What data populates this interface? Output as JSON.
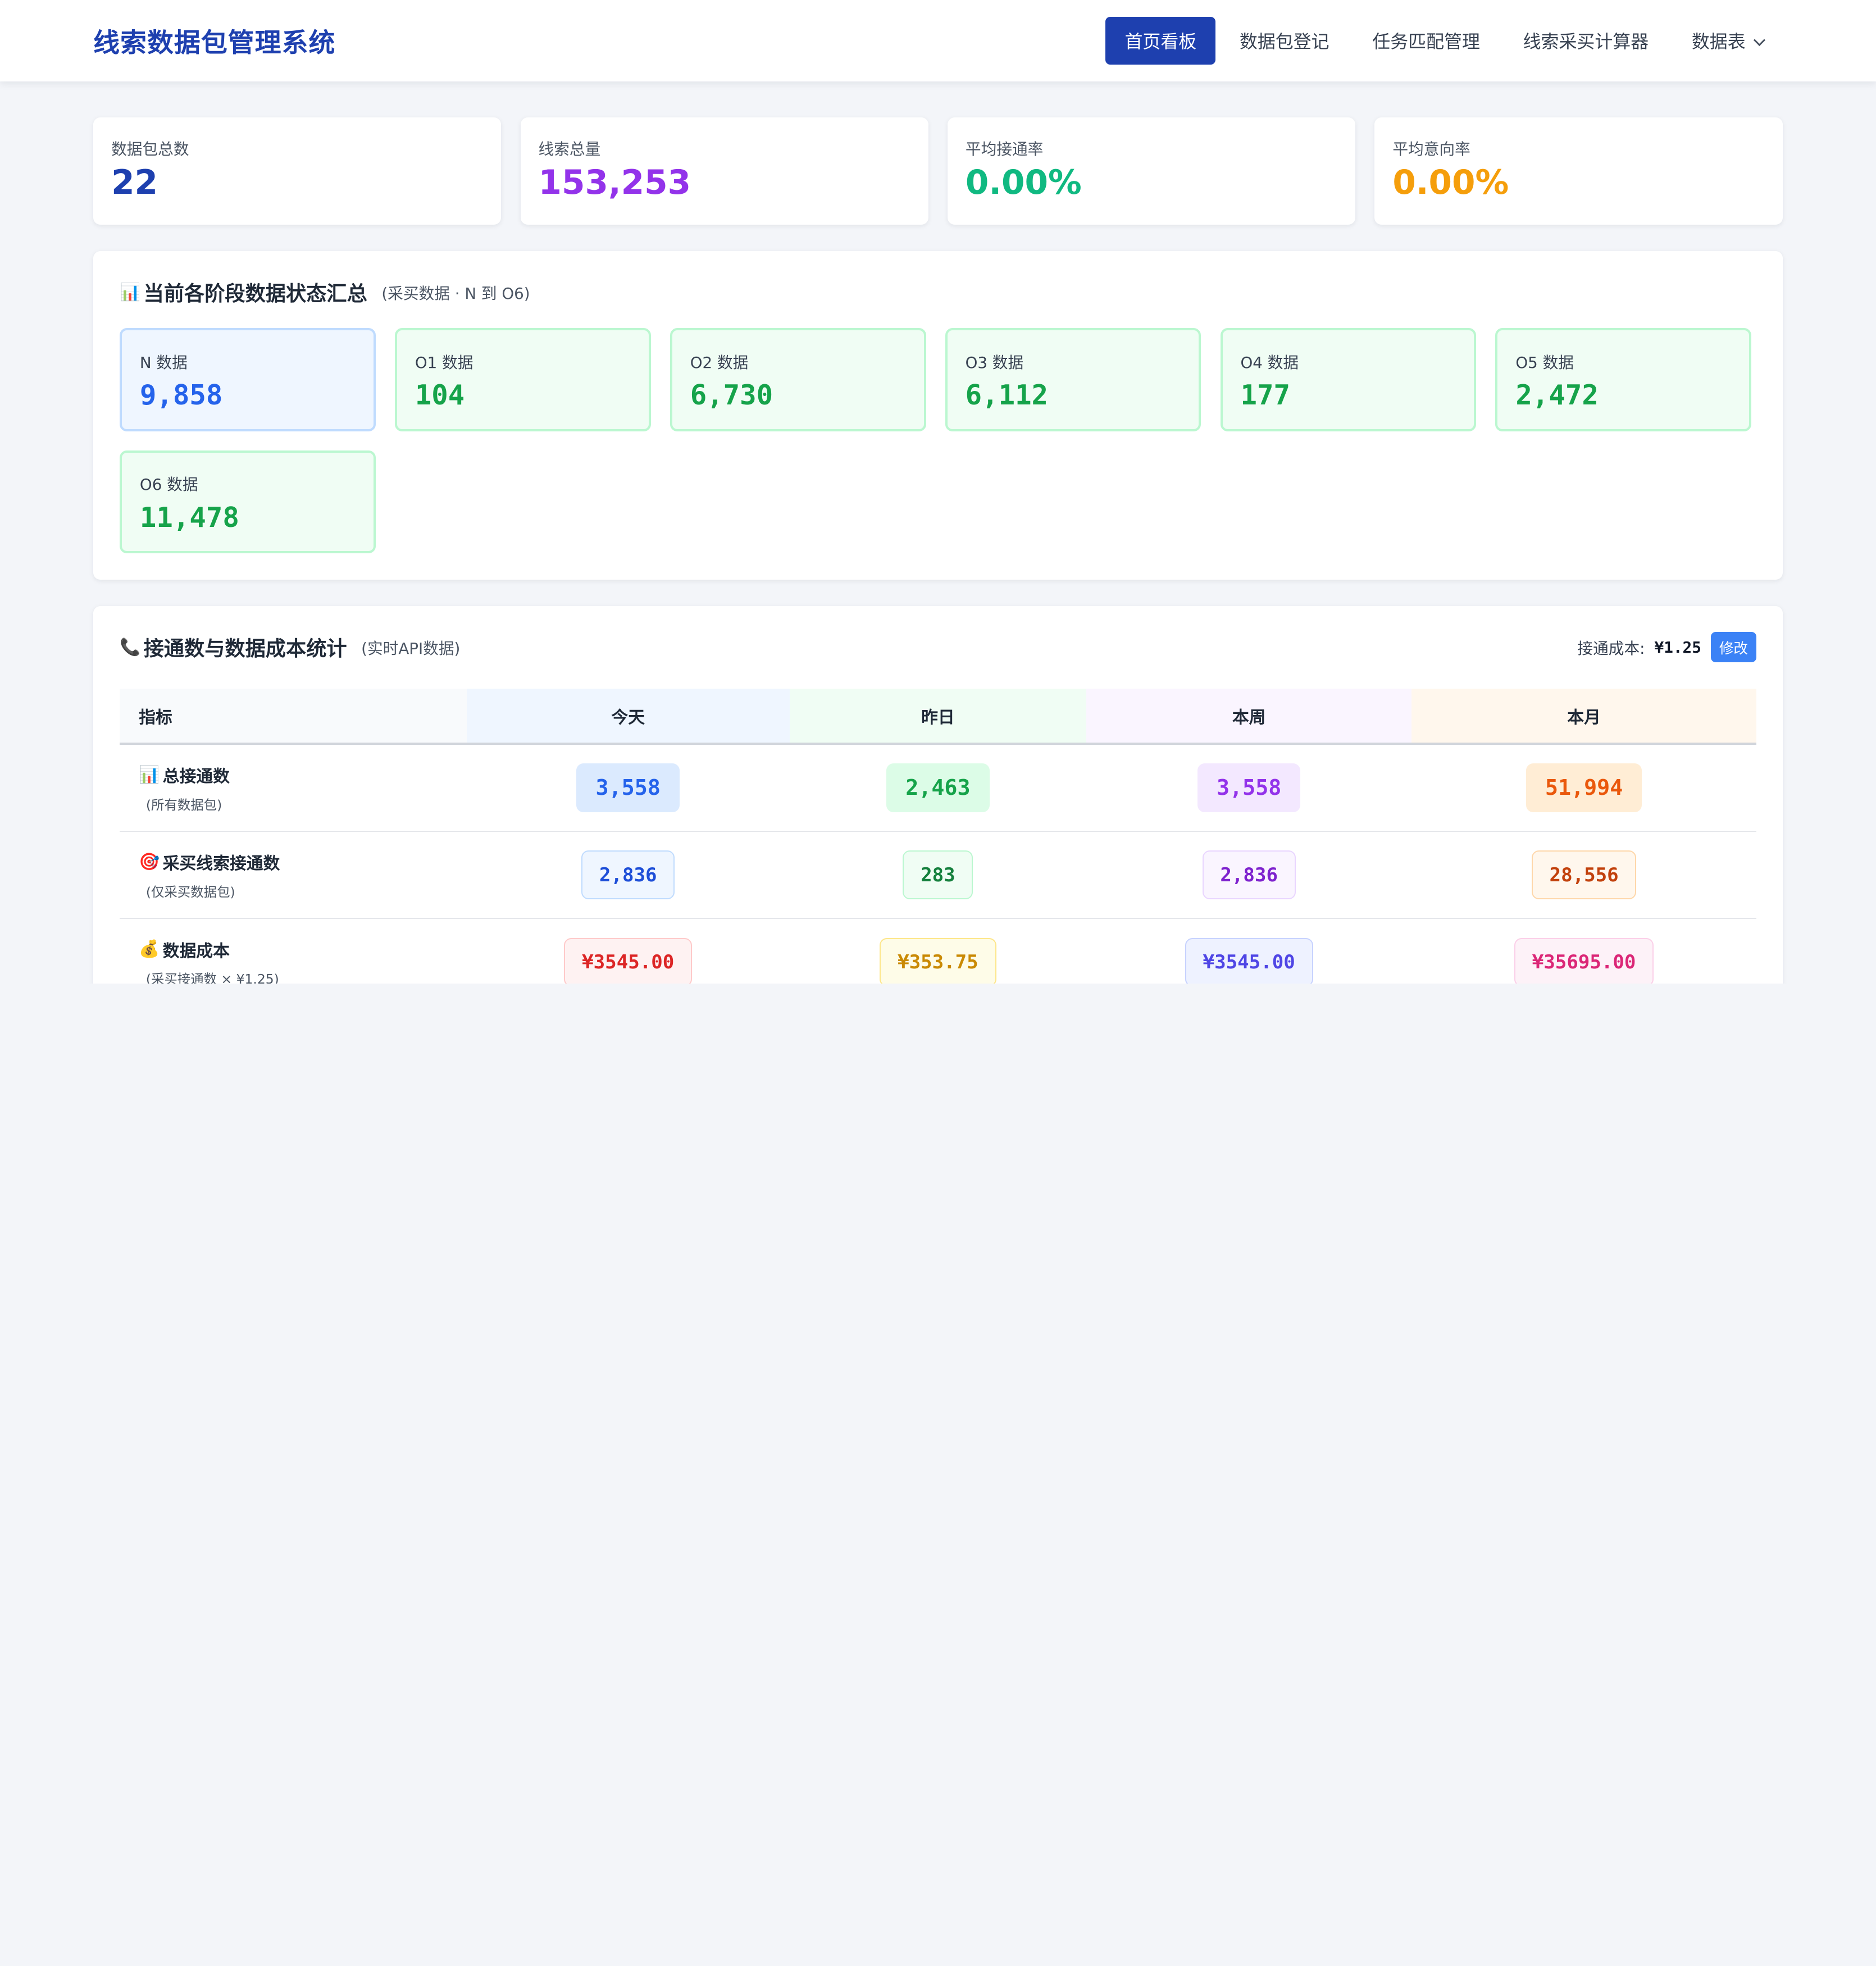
{
  "app": {
    "title": "线索数据包管理系统"
  },
  "nav": {
    "items": [
      {
        "label": "首页看板"
      },
      {
        "label": "数据包登记"
      },
      {
        "label": "任务匹配管理"
      },
      {
        "label": "线索采买计算器"
      },
      {
        "label": "数据表"
      }
    ]
  },
  "stats": [
    {
      "label": "数据包总数",
      "value": "22",
      "color": "#1e40af"
    },
    {
      "label": "线索总量",
      "value": "153,253",
      "color": "#9333ea"
    },
    {
      "label": "平均接通率",
      "value": "0.00%",
      "color": "#10b981"
    },
    {
      "label": "平均意向率",
      "value": "0.00%",
      "color": "#f59e0b"
    }
  ],
  "stage_panel": {
    "icon": "bar-chart-icon",
    "title": "当前各阶段数据状态汇总",
    "subtitle": "(采买数据 · N 到 O6)",
    "stages": [
      {
        "label": "N 数据",
        "value": "9,858"
      },
      {
        "label": "O1 数据",
        "value": "104"
      },
      {
        "label": "O2 数据",
        "value": "6,730"
      },
      {
        "label": "O3 数据",
        "value": "6,112"
      },
      {
        "label": "O4 数据",
        "value": "177"
      },
      {
        "label": "O5 数据",
        "value": "2,472"
      },
      {
        "label": "O6 数据",
        "value": "11,478"
      }
    ]
  },
  "cost_panel": {
    "icon": "phone-icon",
    "title": "接通数与数据成本统计",
    "subtitle": "(实时API数据)",
    "cost_label": "接通成本:",
    "cost_value": "¥1.25",
    "edit_label": "修改",
    "columns": [
      "指标",
      "今天",
      "昨日",
      "本周",
      "本月"
    ],
    "rows": [
      {
        "icon": "bar-chart-icon",
        "title": "总接通数",
        "sub": "(所有数据包)",
        "values": [
          "3,558",
          "2,463",
          "3,558",
          "51,994"
        ]
      },
      {
        "icon": "target-icon",
        "title": "采买线索接通数",
        "sub": "(仅采买数据包)",
        "values": [
          "2,836",
          "283",
          "2,836",
          "28,556"
        ]
      },
      {
        "icon": "money-bag-icon",
        "title": "数据成本",
        "sub": "(采买接通数 × ¥1.25)",
        "values": [
          "¥3545.00",
          "¥353.75",
          "¥3545.00",
          "¥35695.00"
        ]
      }
    ]
  }
}
